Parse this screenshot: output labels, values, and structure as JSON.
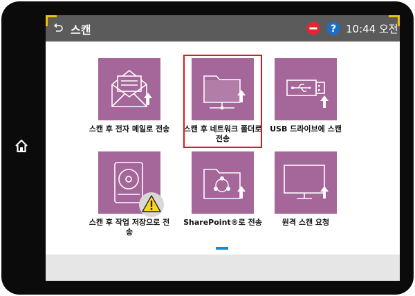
{
  "header": {
    "title": "스캔",
    "time": "10:44 오전",
    "icons": [
      "back-arrow-icon",
      "stop-icon",
      "help-icon"
    ]
  },
  "tiles": [
    {
      "label": "스캔 후 전자 메일로 전송",
      "icon": "email-envelope-icon"
    },
    {
      "label": "스캔 후 네트워크 폴더로 전송",
      "icon": "network-folder-icon",
      "highlighted": true
    },
    {
      "label": "USB 드라이브에 스캔",
      "icon": "usb-drive-icon"
    },
    {
      "label": "스캔 후 작업 저장으로 전송",
      "icon": "job-storage-icon",
      "warning": true
    },
    {
      "label": "SharePoint®로 전송",
      "icon": "sharepoint-folder-icon"
    },
    {
      "label": "원격 스캔 요청",
      "icon": "remote-monitor-icon"
    }
  ],
  "colors": {
    "tile": "#a5679a",
    "header": "#5b5b5b",
    "highlight": "#e0161b",
    "accent": "#1b87d3",
    "corner": "#f2c200"
  }
}
